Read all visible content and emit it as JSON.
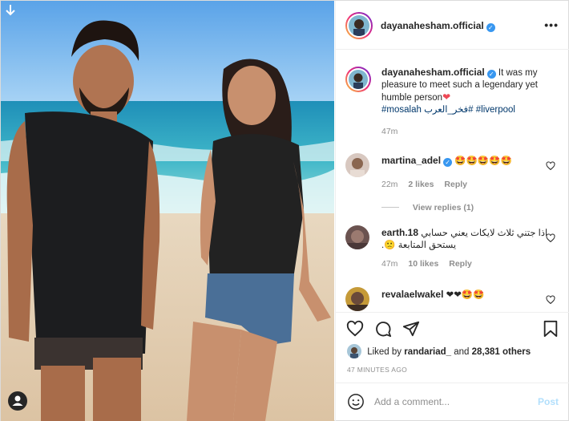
{
  "post": {
    "username": "dayanahesham.official",
    "verified": true,
    "caption_text": "It was my pleasure to meet such a legendary yet humble person",
    "caption_emoji": "heart",
    "hashtags": [
      "#mosalah",
      "#فخر_العرب",
      "#liverpool"
    ],
    "caption_time": "47m"
  },
  "comments": [
    {
      "username": "martina_adel",
      "verified": true,
      "text": "🤩🤩🤩🤩🤩",
      "time": "22m",
      "likes": "2 likes",
      "reply": "Reply",
      "view_replies": "View replies (1)"
    },
    {
      "username": "earth.18",
      "text": "اذا جتني ثلاث لايكات يعني حسابي يستحق المتابعة 🙁.",
      "time": "47m",
      "likes": "10 likes",
      "reply": "Reply"
    },
    {
      "username": "revalaelwakel",
      "text": "❤❤🤩🤩"
    }
  ],
  "liked_by": {
    "prefix": "Liked by",
    "user": "randariad_",
    "connector": "and",
    "count": "28,381 others"
  },
  "time_ago": "47 MINUTES AGO",
  "add_comment": {
    "placeholder": "Add a comment...",
    "post_label": "Post"
  },
  "icons": {
    "download": "download-arrow-icon",
    "user_tag": "user-tag-icon",
    "more": "more-options-icon",
    "like": "heart-icon",
    "comment": "comment-icon",
    "share": "paper-plane-icon",
    "save": "bookmark-icon",
    "emoji": "smiley-icon"
  },
  "colors": {
    "link": "#00376b",
    "verified": "#3897f0",
    "muted": "#8e8e8e",
    "post_disabled": "#b2dffc",
    "heart": "#ed4956"
  }
}
